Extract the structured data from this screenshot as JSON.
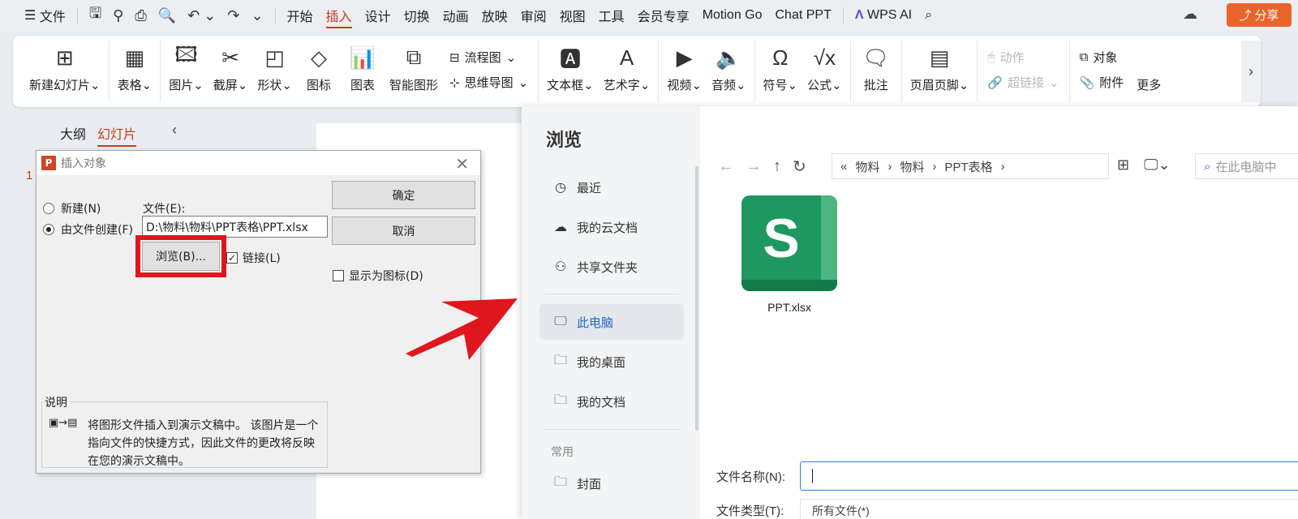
{
  "menu": {
    "file": "文件",
    "items": [
      "开始",
      "插入",
      "设计",
      "切换",
      "动画",
      "放映",
      "审阅",
      "视图",
      "工具",
      "会员专享",
      "Motion Go",
      "Chat PPT"
    ],
    "active": "插入",
    "wps_ai": "WPS AI",
    "share": "分享"
  },
  "ribbon": {
    "new_slide": "新建幻灯片",
    "table": "表格",
    "picture": "图片",
    "screenshot": "截屏",
    "shape": "形状",
    "icon": "图标",
    "chart": "图表",
    "smart_graphic": "智能图形",
    "flowchart": "流程图",
    "mindmap": "思维导图",
    "textbox": "文本框",
    "wordart": "艺术字",
    "video": "视频",
    "audio": "音频",
    "symbol": "符号",
    "formula": "公式",
    "comment": "批注",
    "header_footer": "页眉页脚",
    "action": "动作",
    "hyperlink": "超链接",
    "object": "对象",
    "attachment": "附件",
    "more": "更多"
  },
  "left_panel": {
    "tab_outline": "大纲",
    "tab_slides": "幻灯片",
    "slide_number": "1"
  },
  "dialog": {
    "title": "插入对象",
    "new_label": "新建(N)",
    "from_file_label": "由文件创建(F)",
    "file_label": "文件(E):",
    "file_path": "D:\\物料\\物料\\PPT表格\\PPT.xlsx",
    "browse_button": "浏览(B)...",
    "link_label": "链接(L)",
    "link_checked": true,
    "ok_button": "确定",
    "cancel_button": "取消",
    "show_icon_label": "显示为图标(D)",
    "note_title": "说明",
    "note_text": "将图形文件插入到演示文稿中。 该图片是一个指向文件的快捷方式，因此文件的更改将反映在您的演示文稿中。"
  },
  "browser": {
    "title": "浏览",
    "nav": [
      "最近",
      "我的云文档",
      "共享文件夹",
      "此电脑",
      "我的桌面",
      "我的文档"
    ],
    "selected_nav": "此电脑",
    "section_common": "常用",
    "common_items": [
      "封面"
    ],
    "breadcrumb": [
      "物料",
      "物料",
      "PPT表格"
    ],
    "search_placeholder": "在此电脑中",
    "file_name": "PPT.xlsx",
    "file_icon_letter": "S",
    "filename_label": "文件名称(N):",
    "filetype_label": "文件类型(T):",
    "filetype_value": "所有文件(*)"
  },
  "colors": {
    "accent": "#c1421c",
    "share_bg": "#e8642b",
    "highlight_box": "#e0161e",
    "xlsx_green": "#1e9860",
    "selected_blue": "#1b66c9"
  }
}
